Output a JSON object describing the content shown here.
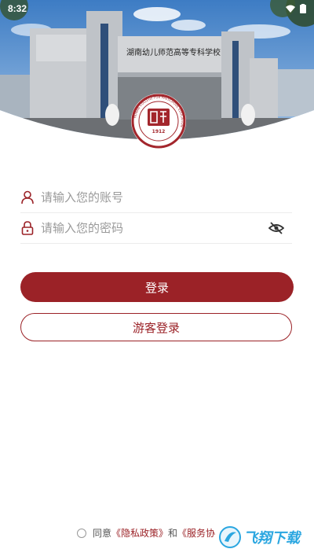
{
  "status": {
    "time": "8:32"
  },
  "hero": {
    "gate_sign": "湖南幼儿师范高等专科学校",
    "logo_year": "1912",
    "logo_ring_text": "HUNAN COLLEGE FOR PRESCHOOL EDUCATION"
  },
  "login": {
    "account_placeholder": "请输入您的账号",
    "password_placeholder": "请输入您的密码",
    "login_button": "登录",
    "guest_button": "游客登录"
  },
  "agreement": {
    "prefix": "同意",
    "privacy_link": "《隐私政策》",
    "and": "和",
    "service_link": "《服务协"
  },
  "watermark": {
    "text": "飞翔下载"
  },
  "colors": {
    "brand": "#9b2227",
    "sky": "#4a86c9"
  }
}
